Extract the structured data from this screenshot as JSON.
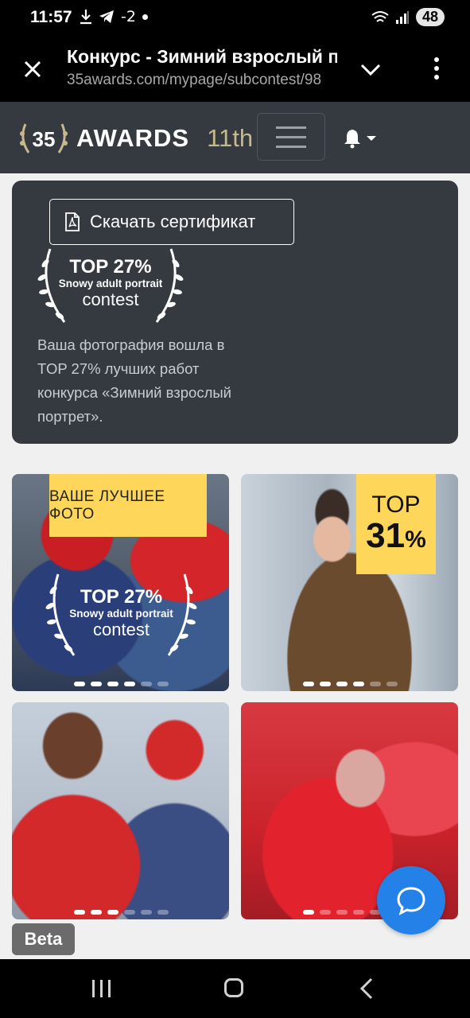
{
  "status_bar": {
    "time": "11:57",
    "left_icons": [
      "download-icon",
      "telegram-icon"
    ],
    "sim_text": "-2",
    "battery": "48"
  },
  "browser": {
    "title": "Конкурс - Зимний взрослый портрет",
    "url": "35awards.com/mypage/subcontest/98"
  },
  "navbar": {
    "brand": "AWARDS",
    "edition": "11th",
    "logo_mark": "35"
  },
  "certificate": {
    "button_label": "Скачать сертификат",
    "badge": {
      "top": "TOP 27%",
      "line2": "Snowy adult portrait",
      "line3": "contest"
    },
    "text": "Ваша фотография вошла в TOP 27% лучших работ конкурса «Зимний взрослый портрет»."
  },
  "photos": [
    {
      "label": "ВАШЕ ЛУЧШЕЕ ФОТО",
      "badge": {
        "top": "TOP 27%",
        "line2": "Snowy adult portrait",
        "line3": "contest"
      },
      "dots_total": 6,
      "dots_active": 4
    },
    {
      "top_word": "TOP",
      "top_number": "31",
      "top_percent": "%",
      "dots_total": 6,
      "dots_active": 4
    },
    {
      "dots_total": 6,
      "dots_active": 3
    },
    {
      "dots_total": 6,
      "dots_active": 1
    }
  ],
  "beta_label": "Beta",
  "colors": {
    "navbar": "#343a40",
    "accent_yellow": "#fdd65a",
    "chat_button": "#2381e8",
    "edition_gold": "#c8b98a"
  }
}
